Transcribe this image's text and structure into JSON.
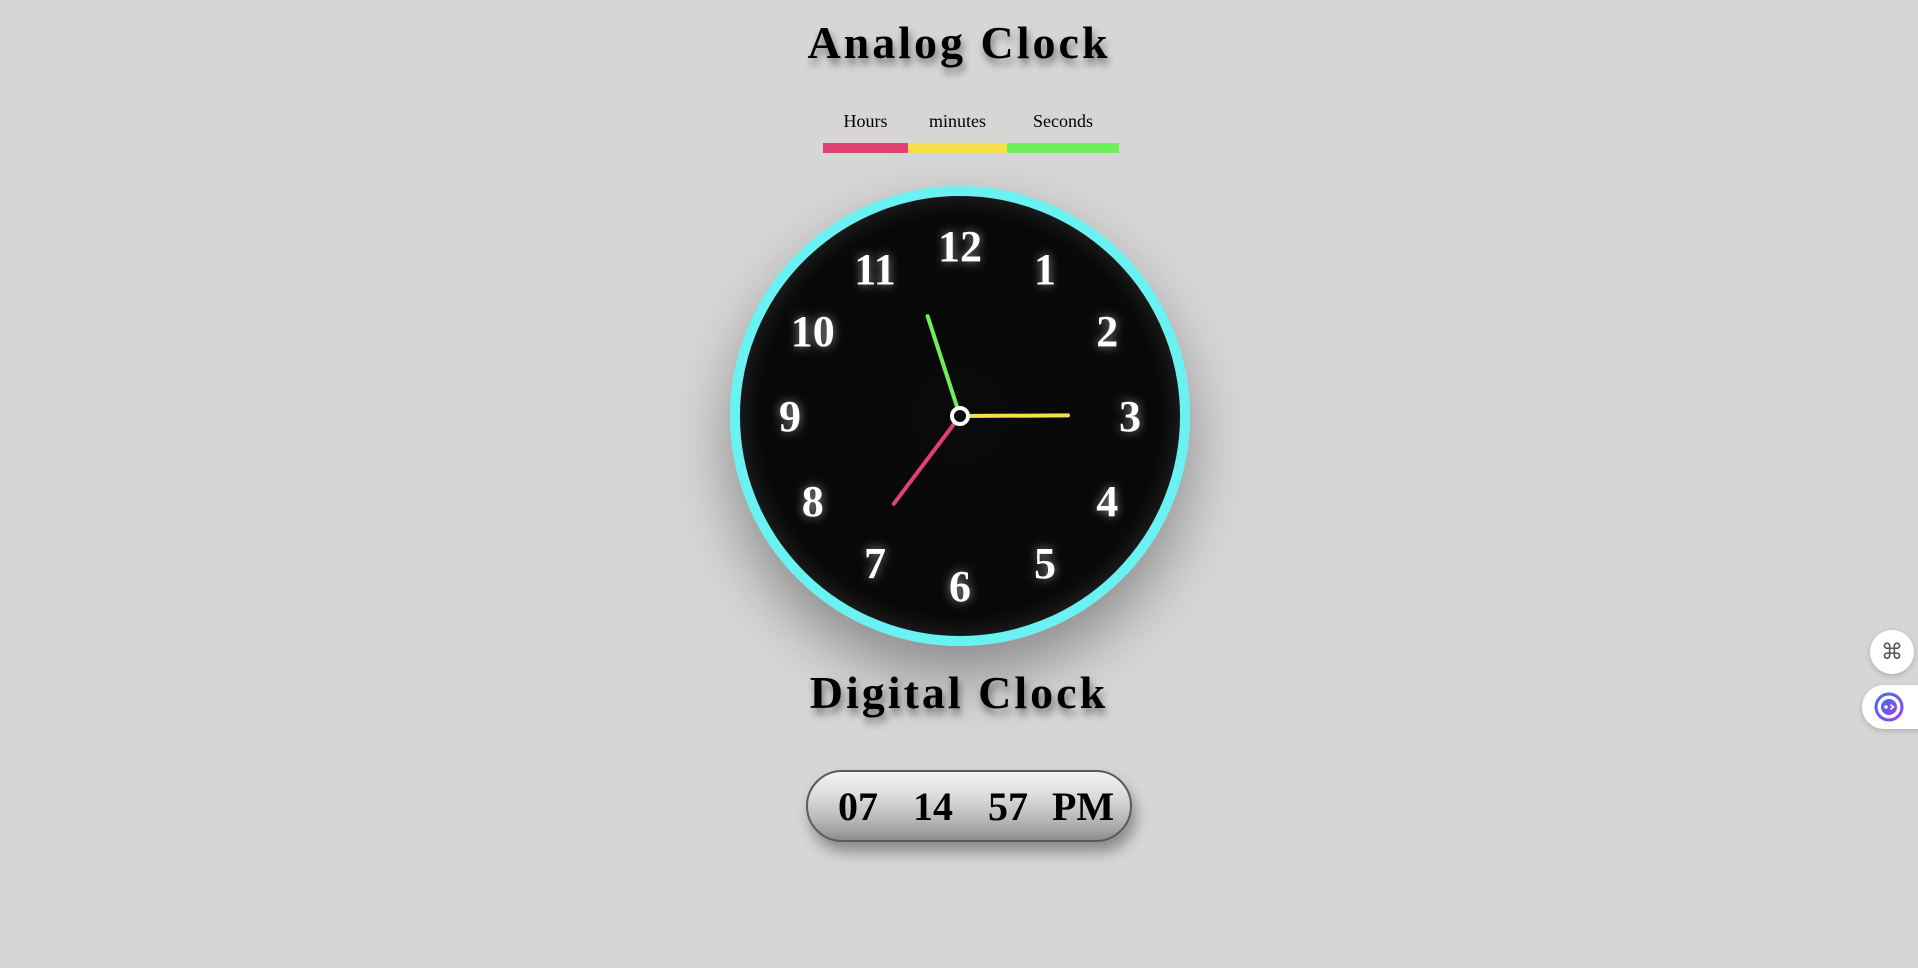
{
  "analog_title": "Analog Clock",
  "digital_title": "Digital Clock",
  "legend": [
    {
      "label": "Hours",
      "color": "#e0416e"
    },
    {
      "label": "minutes",
      "color": "#f6e04a"
    },
    {
      "label": "Seconds",
      "color": "#6ff05a"
    }
  ],
  "clock": {
    "rim_color": "#6af2f2",
    "face_color": "#070707",
    "numerals": [
      "12",
      "1",
      "2",
      "3",
      "4",
      "5",
      "6",
      "7",
      "8",
      "9",
      "10",
      "11"
    ],
    "time": {
      "hour": 7,
      "minute": 14,
      "second": 57
    },
    "hand_colors": {
      "hour": "#e0416e",
      "minute": "#f6e04a",
      "second": "#6ff05a"
    }
  },
  "digital": {
    "hours": "07",
    "minutes": "14",
    "seconds": "57",
    "ampm": "PM"
  },
  "floating": {
    "command_icon": "⌘",
    "assistant_icon": "assistant-bot-icon"
  }
}
